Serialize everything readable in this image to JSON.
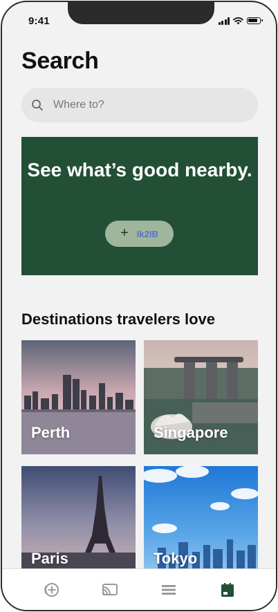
{
  "status_bar": {
    "time": "9:41"
  },
  "page": {
    "title": "Search"
  },
  "search": {
    "placeholder": "Where to?",
    "value": ""
  },
  "promo": {
    "headline": "See what’s good nearby.",
    "button_label": "Ik2lB",
    "background": "#234f37"
  },
  "destinations": {
    "title": "Destinations travelers love",
    "items": [
      {
        "name": "Perth"
      },
      {
        "name": "Singapore"
      },
      {
        "name": "Paris"
      },
      {
        "name": "Tokyo"
      }
    ]
  },
  "tab_bar": {
    "items": [
      {
        "icon": "add-circle-icon",
        "active": false
      },
      {
        "icon": "cast-icon",
        "active": false
      },
      {
        "icon": "menu-icon",
        "active": false
      },
      {
        "icon": "calendar-icon",
        "active": true
      }
    ],
    "active_color": "#234f37",
    "inactive_color": "#999999"
  }
}
